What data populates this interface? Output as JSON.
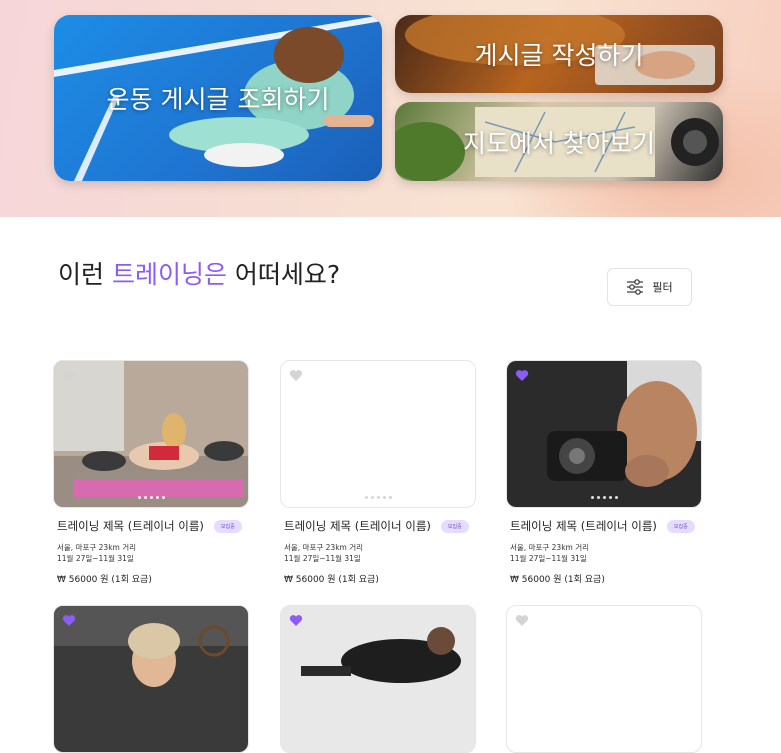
{
  "hero": {
    "tiles": [
      {
        "label": "운동 게시글 조회하기"
      },
      {
        "label": "게시글 작성하기"
      },
      {
        "label": "지도에서 찾아보기"
      }
    ]
  },
  "section": {
    "title_prefix": "이런 ",
    "title_accent": "트레이닝은",
    "title_suffix": " 어떠세요?"
  },
  "filter": {
    "label": "필터",
    "icon": "sliders-icon"
  },
  "colors": {
    "accent": "#8b5cf6",
    "heart_active": "#8b5cf6",
    "heart_inactive": "#d4d4d4"
  },
  "cards": [
    {
      "title": "트레이닝 제목 (트레이너 이름)",
      "badge": "모집중",
      "location": "서울, 마포구 23km 거리",
      "period": "11월 27일~11월 31일",
      "price": "₩ 56000 원 (1회 요금)",
      "liked": false
    },
    {
      "title": "트레이닝 제목 (트레이너 이름)",
      "badge": "모집중",
      "location": "서울, 마포구 23km 거리",
      "period": "11월 27일~11월 31일",
      "price": "₩ 56000 원 (1회 요금)",
      "liked": false
    },
    {
      "title": "트레이닝 제목 (트레이너 이름)",
      "badge": "모집중",
      "location": "서울, 마포구 23km 거리",
      "period": "11월 27일~11월 31일",
      "price": "₩ 56000 원 (1회 요금)",
      "liked": true
    },
    {
      "liked": true
    },
    {
      "liked": true
    },
    {
      "liked": false
    }
  ]
}
